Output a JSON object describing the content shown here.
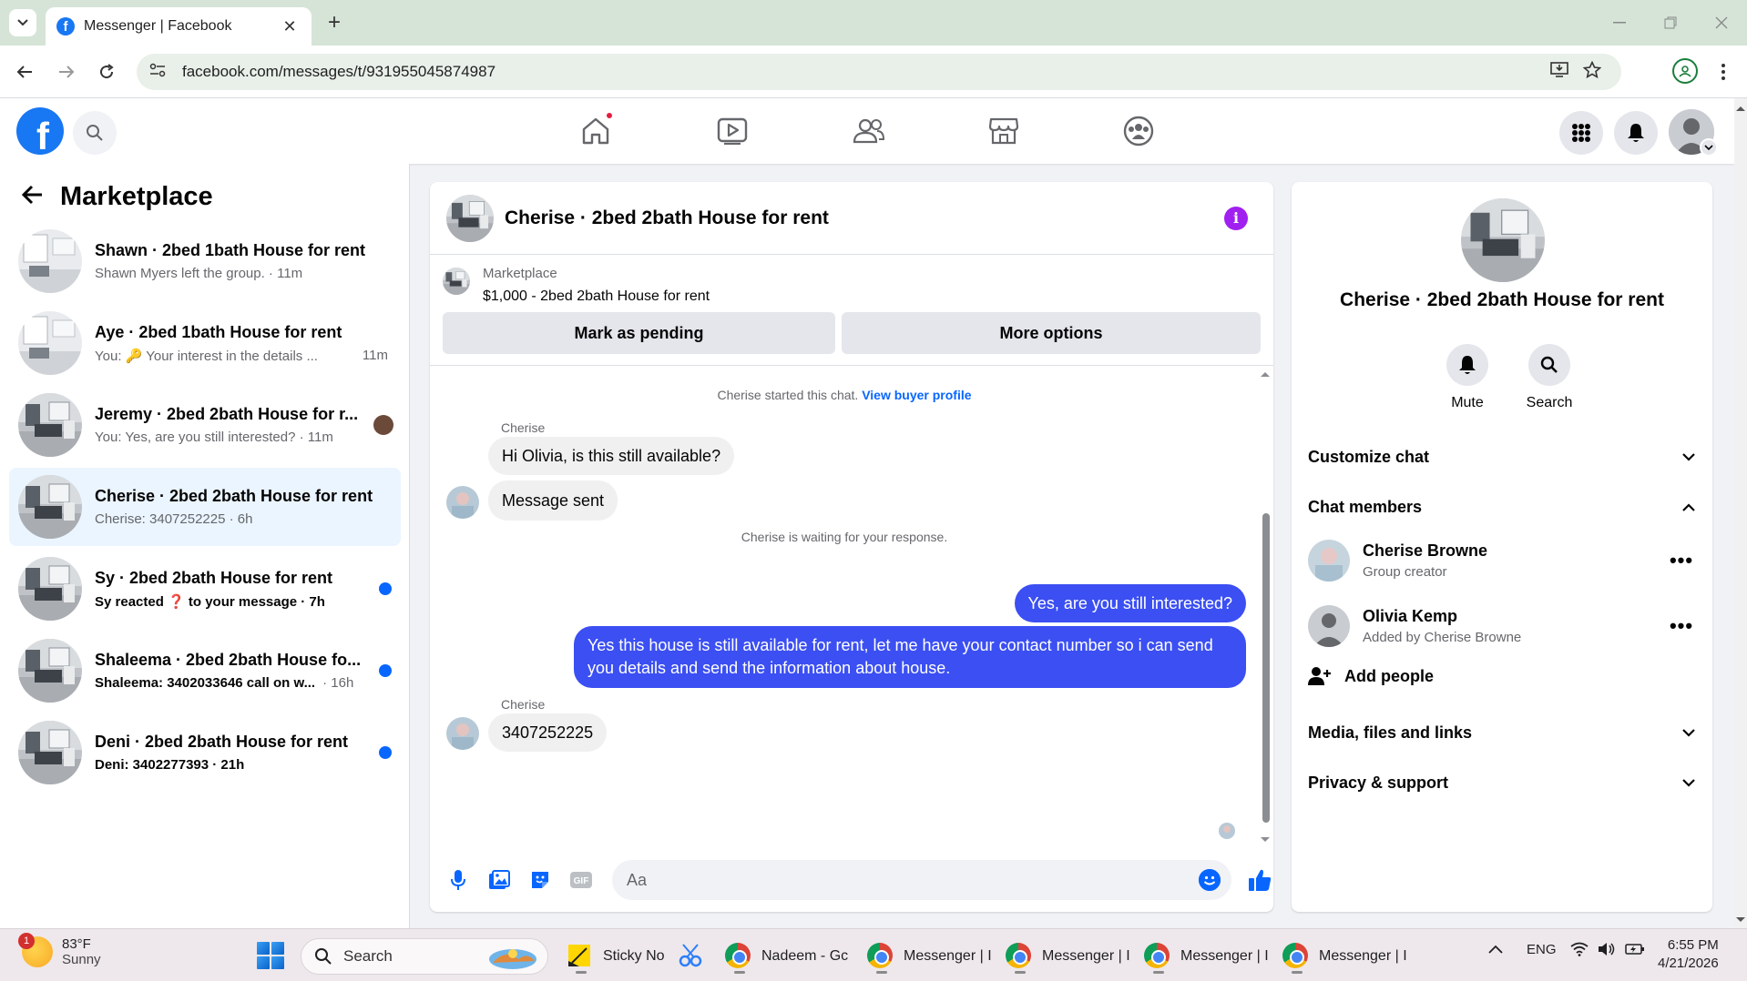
{
  "browser": {
    "tab_title": "Messenger | Facebook",
    "tab_close": "✕",
    "new_tab": "+",
    "url": "facebook.com/messages/t/931955045874987"
  },
  "left_panel": {
    "title": "Marketplace",
    "conversations": [
      {
        "title": "Shawn · 2bed 1bath House for rent",
        "subtitle": "Shawn Myers left the group. · 11m",
        "unread": false
      },
      {
        "title": "Aye · 2bed 1bath House for rent",
        "subtitle": "You: 🔑 Your interest in the details ...",
        "time": "11m",
        "unread": false
      },
      {
        "title": "Jeremy · 2bed 2bath House for r...",
        "subtitle": "You: Yes, are you still interested? · 11m",
        "unread": false
      },
      {
        "title": "Cherise · 2bed 2bath House for rent",
        "subtitle": "Cherise: 3407252225 · 6h",
        "unread": false,
        "active": true
      },
      {
        "title": "Sy · 2bed 2bath House for rent",
        "subtitle": "Sy reacted ❓ to your message · 7h",
        "unread": true
      },
      {
        "title": "Shaleema · 2bed 2bath House fo...",
        "subtitle": "Shaleema: 3402033646 call on w...",
        "time": "· 16h",
        "unread": true
      },
      {
        "title": "Deni · 2bed 2bath House for rent",
        "subtitle": "Deni: 3402277393 · 21h",
        "unread": true
      }
    ]
  },
  "chat": {
    "title": "Cherise · 2bed 2bath House for rent",
    "listing_label": "Marketplace",
    "listing_title": "$1,000 - 2bed 2bath House for rent",
    "mark_pending_label": "Mark as pending",
    "more_options_label": "More options",
    "started_text": "Cherise started this chat.",
    "view_profile_link": "View buyer profile",
    "sender_name_1": "Cherise",
    "msg_1": "Hi Olivia, is this still available?",
    "msg_2": "Message sent",
    "waiting_text": "Cherise is waiting for your response.",
    "msg_out_1": "Yes, are you still interested?",
    "msg_out_2": "Yes this house is still available for rent, let me have your contact number so i can send you details and send the information about house.",
    "sender_name_2": "Cherise",
    "msg_3": "3407252225",
    "composer_placeholder": "Aa",
    "gif_label": "GIF"
  },
  "right_panel": {
    "title": "Cherise · 2bed 2bath House for rent",
    "mute_label": "Mute",
    "search_label": "Search",
    "customize_label": "Customize chat",
    "members_label": "Chat members",
    "members": [
      {
        "name": "Cherise Browne",
        "role": "Group creator"
      },
      {
        "name": "Olivia Kemp",
        "role": "Added by Cherise Browne"
      }
    ],
    "more_dots": "•••",
    "add_people_label": "Add people",
    "media_label": "Media, files and links",
    "privacy_label": "Privacy & support"
  },
  "taskbar": {
    "weather_temp": "83°F",
    "weather_desc": "Sunny",
    "weather_badge": "1",
    "search_label": "Search",
    "apps": [
      {
        "label": "Sticky No"
      },
      {
        "label": "Nadeem - Gc"
      },
      {
        "label": "Messenger | I"
      },
      {
        "label": "Messenger | I"
      },
      {
        "label": "Messenger | I"
      },
      {
        "label": "Messenger | I"
      }
    ],
    "language": "ENG",
    "time": "6:55 PM",
    "date": "4/21/2026"
  },
  "colors": {
    "fb_blue": "#1877f2",
    "outgoing_bubble": "#3b4ff2",
    "unread_dot": "#0866ff",
    "info_icon": "#a020f0"
  }
}
